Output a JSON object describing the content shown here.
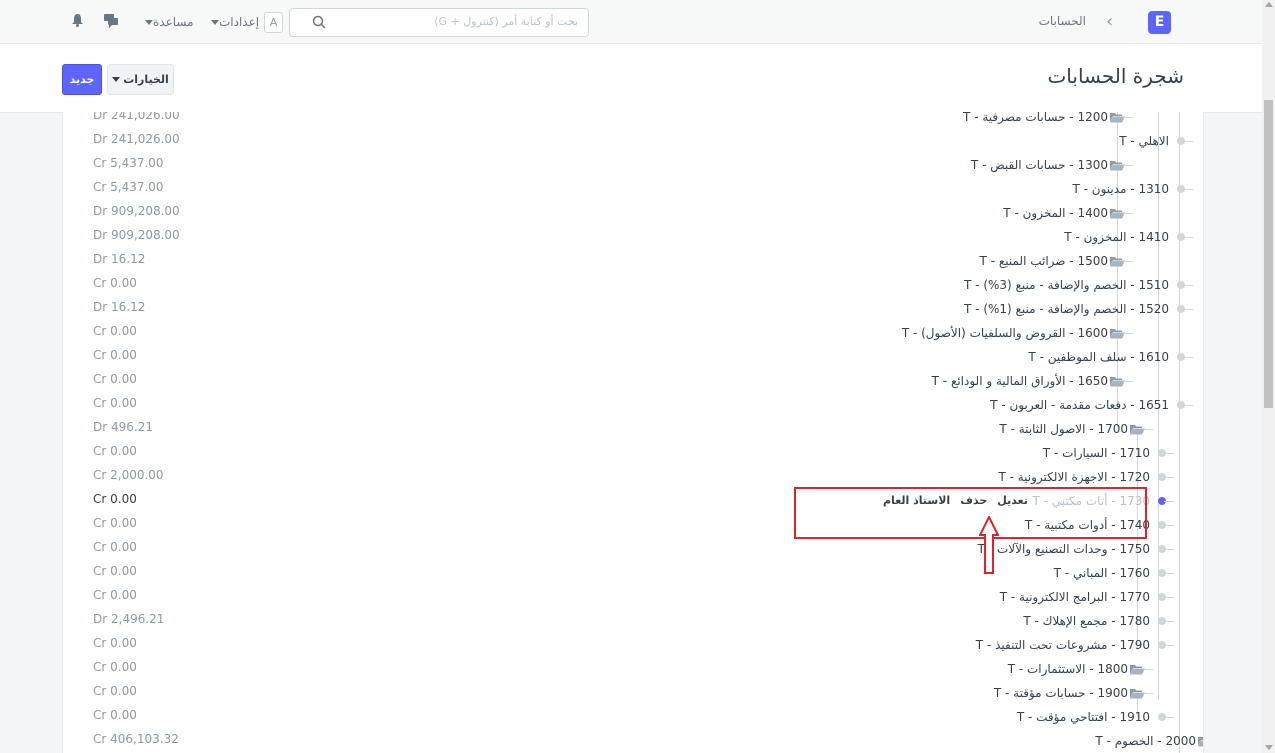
{
  "navbar": {
    "logo": "E",
    "breadcrumb": "الحسابات",
    "search_placeholder": "بحث أو كتابة أمر (كنترول + G)",
    "avatar_letter": "A",
    "settings_label": "إعدادات",
    "help_label": "مساعدة"
  },
  "page": {
    "title": "شجرة الحسابات",
    "new_button": "جديد",
    "options_button": "الخيارات"
  },
  "tree": [
    {
      "label": "1200 - حسابات مصرفية - T",
      "type": "group",
      "balance": "Dr 241,026.00"
    },
    {
      "label": "الاهلي - T",
      "type": "leaf",
      "balance": "Dr 241,026.00"
    },
    {
      "label": "1300 - حسابات القبض - T",
      "type": "group",
      "balance": "Cr 5,437.00"
    },
    {
      "label": "1310 - مدينون - T",
      "type": "leaf",
      "balance": "Cr 5,437.00"
    },
    {
      "label": "1400 - المخزون - T",
      "type": "group",
      "balance": "Dr 909,208.00"
    },
    {
      "label": "1410 - المخزون - T",
      "type": "leaf",
      "balance": "Dr 909,208.00"
    },
    {
      "label": "1500 - ضرائب المنبع - T",
      "type": "group",
      "balance": "Dr 16.12"
    },
    {
      "label": "1510 - الخصم والإضافة - منبع (3%) - T",
      "type": "leaf",
      "balance": "Cr 0.00"
    },
    {
      "label": "1520 - الخصم والإضافة - منبع (1%) - T",
      "type": "leaf",
      "balance": "Dr 16.12"
    },
    {
      "label": "1600 - القروض والسلفيات (الأصول) - T",
      "type": "group",
      "balance": "Cr 0.00"
    },
    {
      "label": "1610 - سلف الموظفين - T",
      "type": "leaf",
      "balance": "Cr 0.00"
    },
    {
      "label": "1650 - الأوراق المالية و الودائع - T",
      "type": "group",
      "balance": "Cr 0.00"
    },
    {
      "label": "1651 - دفعات مقدمة - العربون - T",
      "type": "leaf",
      "balance": "Cr 0.00"
    },
    {
      "label": "1700 - الاصول الثابتة - T",
      "type": "group",
      "balance": "Dr 496.21"
    },
    {
      "label": "1710 - السيارات - T",
      "type": "leaf",
      "balance": "Cr 0.00"
    },
    {
      "label": "1720 - الاجهزة الالكترونية - T",
      "type": "leaf",
      "balance": "Cr 2,000.00"
    },
    {
      "label": "1730 - أثاث مكتبي - T",
      "type": "leaf",
      "balance": "Cr 0.00",
      "active": true
    },
    {
      "label": "1740 - أدوات مكتبية - T",
      "type": "leaf",
      "balance": "Cr 0.00"
    },
    {
      "label": "1750 - وحدات التصنيع والآلات - T",
      "type": "leaf",
      "balance": "Cr 0.00"
    },
    {
      "label": "1760 - المباني - T",
      "type": "leaf",
      "balance": "Cr 0.00"
    },
    {
      "label": "1770 - البرامج الالكترونية - T",
      "type": "leaf",
      "balance": "Cr 0.00"
    },
    {
      "label": "1780 - مجمع الإهلاك - T",
      "type": "leaf",
      "balance": "Dr 2,496.21"
    },
    {
      "label": "1790 - مشروعات تحت التنفيذ - T",
      "type": "leaf",
      "balance": "Cr 0.00"
    },
    {
      "label": "1800 - الاستثمارات - T",
      "type": "group",
      "balance": "Cr 0.00"
    },
    {
      "label": "1900 - حسابات مؤقتة - T",
      "type": "group",
      "balance": "Cr 0.00"
    },
    {
      "label": "1910 - افتتاحي مؤقت - T",
      "type": "leaf",
      "balance": "Cr 0.00"
    },
    {
      "label": "2000 - الخصوم - T",
      "type": "group",
      "balance": "Cr 406,103.32"
    }
  ],
  "node_actions": {
    "edit": "تعديل",
    "delete": "حذف",
    "ledger": "الاستاذ العام"
  },
  "colors": {
    "accent": "#5e64ff",
    "highlight": "#e0242d"
  }
}
